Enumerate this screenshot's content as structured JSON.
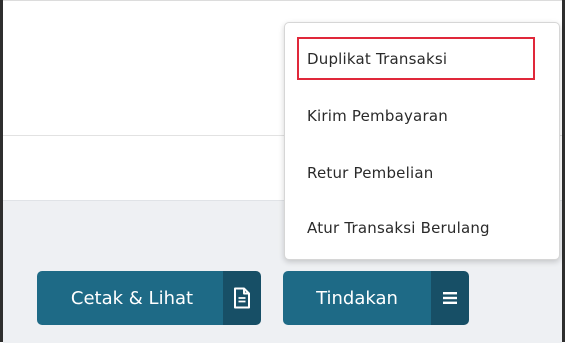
{
  "buttons": {
    "print_view_label": "Cetak & Lihat",
    "print_view_icon": "document-icon",
    "actions_label": "Tindakan",
    "actions_icon": "menu-icon"
  },
  "actions_menu": {
    "items": [
      {
        "label": "Duplikat Transaksi",
        "highlighted": true
      },
      {
        "label": "Kirim Pembayaran",
        "highlighted": false
      },
      {
        "label": "Retur Pembelian",
        "highlighted": false
      },
      {
        "label": "Atur Transaksi Berulang",
        "highlighted": false
      }
    ]
  },
  "colors": {
    "button_primary": "#1e6a86",
    "button_icon_bg": "#174f66",
    "highlight": "#e0283a",
    "footer_bg": "#eef0f3"
  }
}
